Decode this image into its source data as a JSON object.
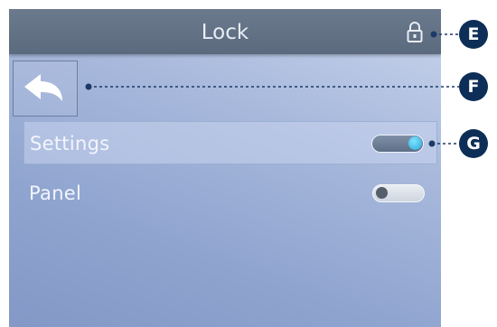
{
  "header": {
    "title": "Lock",
    "lock_icon": "lock-icon"
  },
  "back_button": {
    "icon": "back-arrow-icon"
  },
  "settings_rows": [
    {
      "label": "Settings",
      "toggle_state": "on",
      "selected": true
    },
    {
      "label": "Panel",
      "toggle_state": "off",
      "selected": false
    }
  ],
  "callouts": [
    {
      "label": "E",
      "target": "lock-icon"
    },
    {
      "label": "F",
      "target": "back-button"
    },
    {
      "label": "G",
      "target": "settings-toggle"
    }
  ],
  "colors": {
    "header": "#5f6e82",
    "badge": "#0d2e57",
    "toggle_knob_on": "#2aa7d8"
  }
}
